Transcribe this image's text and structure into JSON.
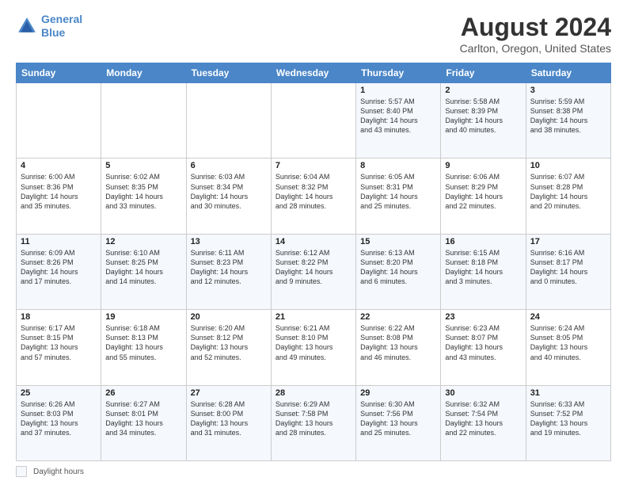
{
  "logo": {
    "line1": "General",
    "line2": "Blue"
  },
  "title": "August 2024",
  "subtitle": "Carlton, Oregon, United States",
  "header_days": [
    "Sunday",
    "Monday",
    "Tuesday",
    "Wednesday",
    "Thursday",
    "Friday",
    "Saturday"
  ],
  "footer_label": "Daylight hours",
  "weeks": [
    [
      {
        "day": "",
        "info": ""
      },
      {
        "day": "",
        "info": ""
      },
      {
        "day": "",
        "info": ""
      },
      {
        "day": "",
        "info": ""
      },
      {
        "day": "1",
        "info": "Sunrise: 5:57 AM\nSunset: 8:40 PM\nDaylight: 14 hours\nand 43 minutes."
      },
      {
        "day": "2",
        "info": "Sunrise: 5:58 AM\nSunset: 8:39 PM\nDaylight: 14 hours\nand 40 minutes."
      },
      {
        "day": "3",
        "info": "Sunrise: 5:59 AM\nSunset: 8:38 PM\nDaylight: 14 hours\nand 38 minutes."
      }
    ],
    [
      {
        "day": "4",
        "info": "Sunrise: 6:00 AM\nSunset: 8:36 PM\nDaylight: 14 hours\nand 35 minutes."
      },
      {
        "day": "5",
        "info": "Sunrise: 6:02 AM\nSunset: 8:35 PM\nDaylight: 14 hours\nand 33 minutes."
      },
      {
        "day": "6",
        "info": "Sunrise: 6:03 AM\nSunset: 8:34 PM\nDaylight: 14 hours\nand 30 minutes."
      },
      {
        "day": "7",
        "info": "Sunrise: 6:04 AM\nSunset: 8:32 PM\nDaylight: 14 hours\nand 28 minutes."
      },
      {
        "day": "8",
        "info": "Sunrise: 6:05 AM\nSunset: 8:31 PM\nDaylight: 14 hours\nand 25 minutes."
      },
      {
        "day": "9",
        "info": "Sunrise: 6:06 AM\nSunset: 8:29 PM\nDaylight: 14 hours\nand 22 minutes."
      },
      {
        "day": "10",
        "info": "Sunrise: 6:07 AM\nSunset: 8:28 PM\nDaylight: 14 hours\nand 20 minutes."
      }
    ],
    [
      {
        "day": "11",
        "info": "Sunrise: 6:09 AM\nSunset: 8:26 PM\nDaylight: 14 hours\nand 17 minutes."
      },
      {
        "day": "12",
        "info": "Sunrise: 6:10 AM\nSunset: 8:25 PM\nDaylight: 14 hours\nand 14 minutes."
      },
      {
        "day": "13",
        "info": "Sunrise: 6:11 AM\nSunset: 8:23 PM\nDaylight: 14 hours\nand 12 minutes."
      },
      {
        "day": "14",
        "info": "Sunrise: 6:12 AM\nSunset: 8:22 PM\nDaylight: 14 hours\nand 9 minutes."
      },
      {
        "day": "15",
        "info": "Sunrise: 6:13 AM\nSunset: 8:20 PM\nDaylight: 14 hours\nand 6 minutes."
      },
      {
        "day": "16",
        "info": "Sunrise: 6:15 AM\nSunset: 8:18 PM\nDaylight: 14 hours\nand 3 minutes."
      },
      {
        "day": "17",
        "info": "Sunrise: 6:16 AM\nSunset: 8:17 PM\nDaylight: 14 hours\nand 0 minutes."
      }
    ],
    [
      {
        "day": "18",
        "info": "Sunrise: 6:17 AM\nSunset: 8:15 PM\nDaylight: 13 hours\nand 57 minutes."
      },
      {
        "day": "19",
        "info": "Sunrise: 6:18 AM\nSunset: 8:13 PM\nDaylight: 13 hours\nand 55 minutes."
      },
      {
        "day": "20",
        "info": "Sunrise: 6:20 AM\nSunset: 8:12 PM\nDaylight: 13 hours\nand 52 minutes."
      },
      {
        "day": "21",
        "info": "Sunrise: 6:21 AM\nSunset: 8:10 PM\nDaylight: 13 hours\nand 49 minutes."
      },
      {
        "day": "22",
        "info": "Sunrise: 6:22 AM\nSunset: 8:08 PM\nDaylight: 13 hours\nand 46 minutes."
      },
      {
        "day": "23",
        "info": "Sunrise: 6:23 AM\nSunset: 8:07 PM\nDaylight: 13 hours\nand 43 minutes."
      },
      {
        "day": "24",
        "info": "Sunrise: 6:24 AM\nSunset: 8:05 PM\nDaylight: 13 hours\nand 40 minutes."
      }
    ],
    [
      {
        "day": "25",
        "info": "Sunrise: 6:26 AM\nSunset: 8:03 PM\nDaylight: 13 hours\nand 37 minutes."
      },
      {
        "day": "26",
        "info": "Sunrise: 6:27 AM\nSunset: 8:01 PM\nDaylight: 13 hours\nand 34 minutes."
      },
      {
        "day": "27",
        "info": "Sunrise: 6:28 AM\nSunset: 8:00 PM\nDaylight: 13 hours\nand 31 minutes."
      },
      {
        "day": "28",
        "info": "Sunrise: 6:29 AM\nSunset: 7:58 PM\nDaylight: 13 hours\nand 28 minutes."
      },
      {
        "day": "29",
        "info": "Sunrise: 6:30 AM\nSunset: 7:56 PM\nDaylight: 13 hours\nand 25 minutes."
      },
      {
        "day": "30",
        "info": "Sunrise: 6:32 AM\nSunset: 7:54 PM\nDaylight: 13 hours\nand 22 minutes."
      },
      {
        "day": "31",
        "info": "Sunrise: 6:33 AM\nSunset: 7:52 PM\nDaylight: 13 hours\nand 19 minutes."
      }
    ]
  ]
}
